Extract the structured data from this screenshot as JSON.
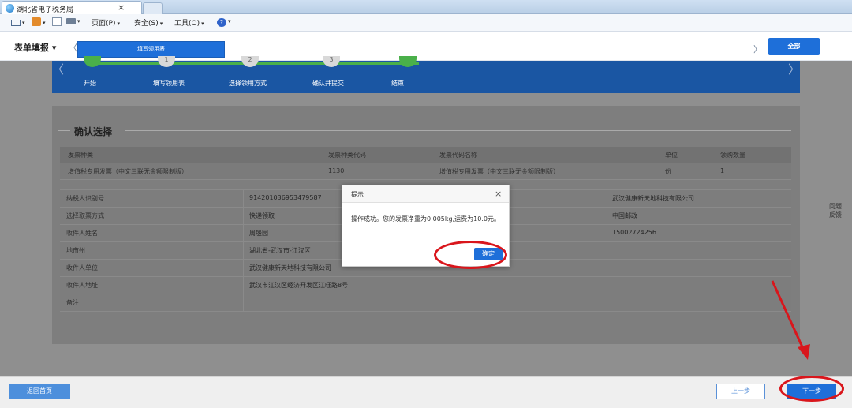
{
  "browser": {
    "tab_title": "湖北省电子税务局",
    "tab_close": "×"
  },
  "command_bar": {
    "page_menu": "页面(P)",
    "safety_menu": "安全(S)",
    "tools_menu": "工具(O)"
  },
  "header": {
    "menu_title": "表单填报",
    "menu_caret": "▾",
    "nav_left": "〈",
    "nav_right": "〉",
    "active_tab": "填写领用表",
    "all_button": "全部"
  },
  "steps": {
    "arrow_left": "〈",
    "arrow_right": "〉",
    "items": [
      {
        "label": "开始",
        "number": "",
        "done": true
      },
      {
        "label": "填写领用表",
        "number": "1",
        "done": false
      },
      {
        "label": "选择领用方式",
        "number": "2",
        "done": false
      },
      {
        "label": "确认并提交",
        "number": "3",
        "done": false
      },
      {
        "label": "结束",
        "number": "",
        "done": true
      }
    ]
  },
  "section": {
    "title": "确认选择"
  },
  "invoice_table": {
    "columns": [
      "发票种类",
      "发票种类代码",
      "发票代码名称",
      "单位",
      "领购数量"
    ],
    "rows": [
      [
        "增值税专用发票（中文三联无金额限制版）",
        "1130",
        "增值税专用发票（中文三联无金额限制版）",
        "份",
        "1"
      ]
    ]
  },
  "info": {
    "rows": [
      {
        "label": "纳税人识别号",
        "value": "914201036953479587",
        "value_right": "武汉健康新天地科技有限公司"
      },
      {
        "label": "选择取票方式",
        "value": "快递领取",
        "value_right": "中国邮政"
      },
      {
        "label": "收件人姓名",
        "value": "周殷园",
        "value_right": "15002724256"
      },
      {
        "label": "地市州",
        "value": "湖北省-武汉市-江汉区",
        "value_right": ""
      },
      {
        "label": "收件人单位",
        "value": "武汉健康新天地科技有限公司",
        "value_right": ""
      },
      {
        "label": "收件人地址",
        "value": "武汉市江汉区经济开发区江旺路8号",
        "value_right": ""
      },
      {
        "label": "备注",
        "value": "",
        "value_right": ""
      }
    ]
  },
  "feedback": {
    "line1": "问题",
    "line2": "反馈"
  },
  "footer": {
    "home_button": "返回首页",
    "prev_button": "上一步",
    "next_button": "下一步"
  },
  "dialog": {
    "title": "提示",
    "close": "×",
    "message": "操作成功。您的发票净重为0.005kg,运费为10.0元。",
    "ok_button": "确定"
  },
  "colors": {
    "primary": "#1e6fd9",
    "step_done": "#4ab04a",
    "annotation": "#d9161c"
  }
}
